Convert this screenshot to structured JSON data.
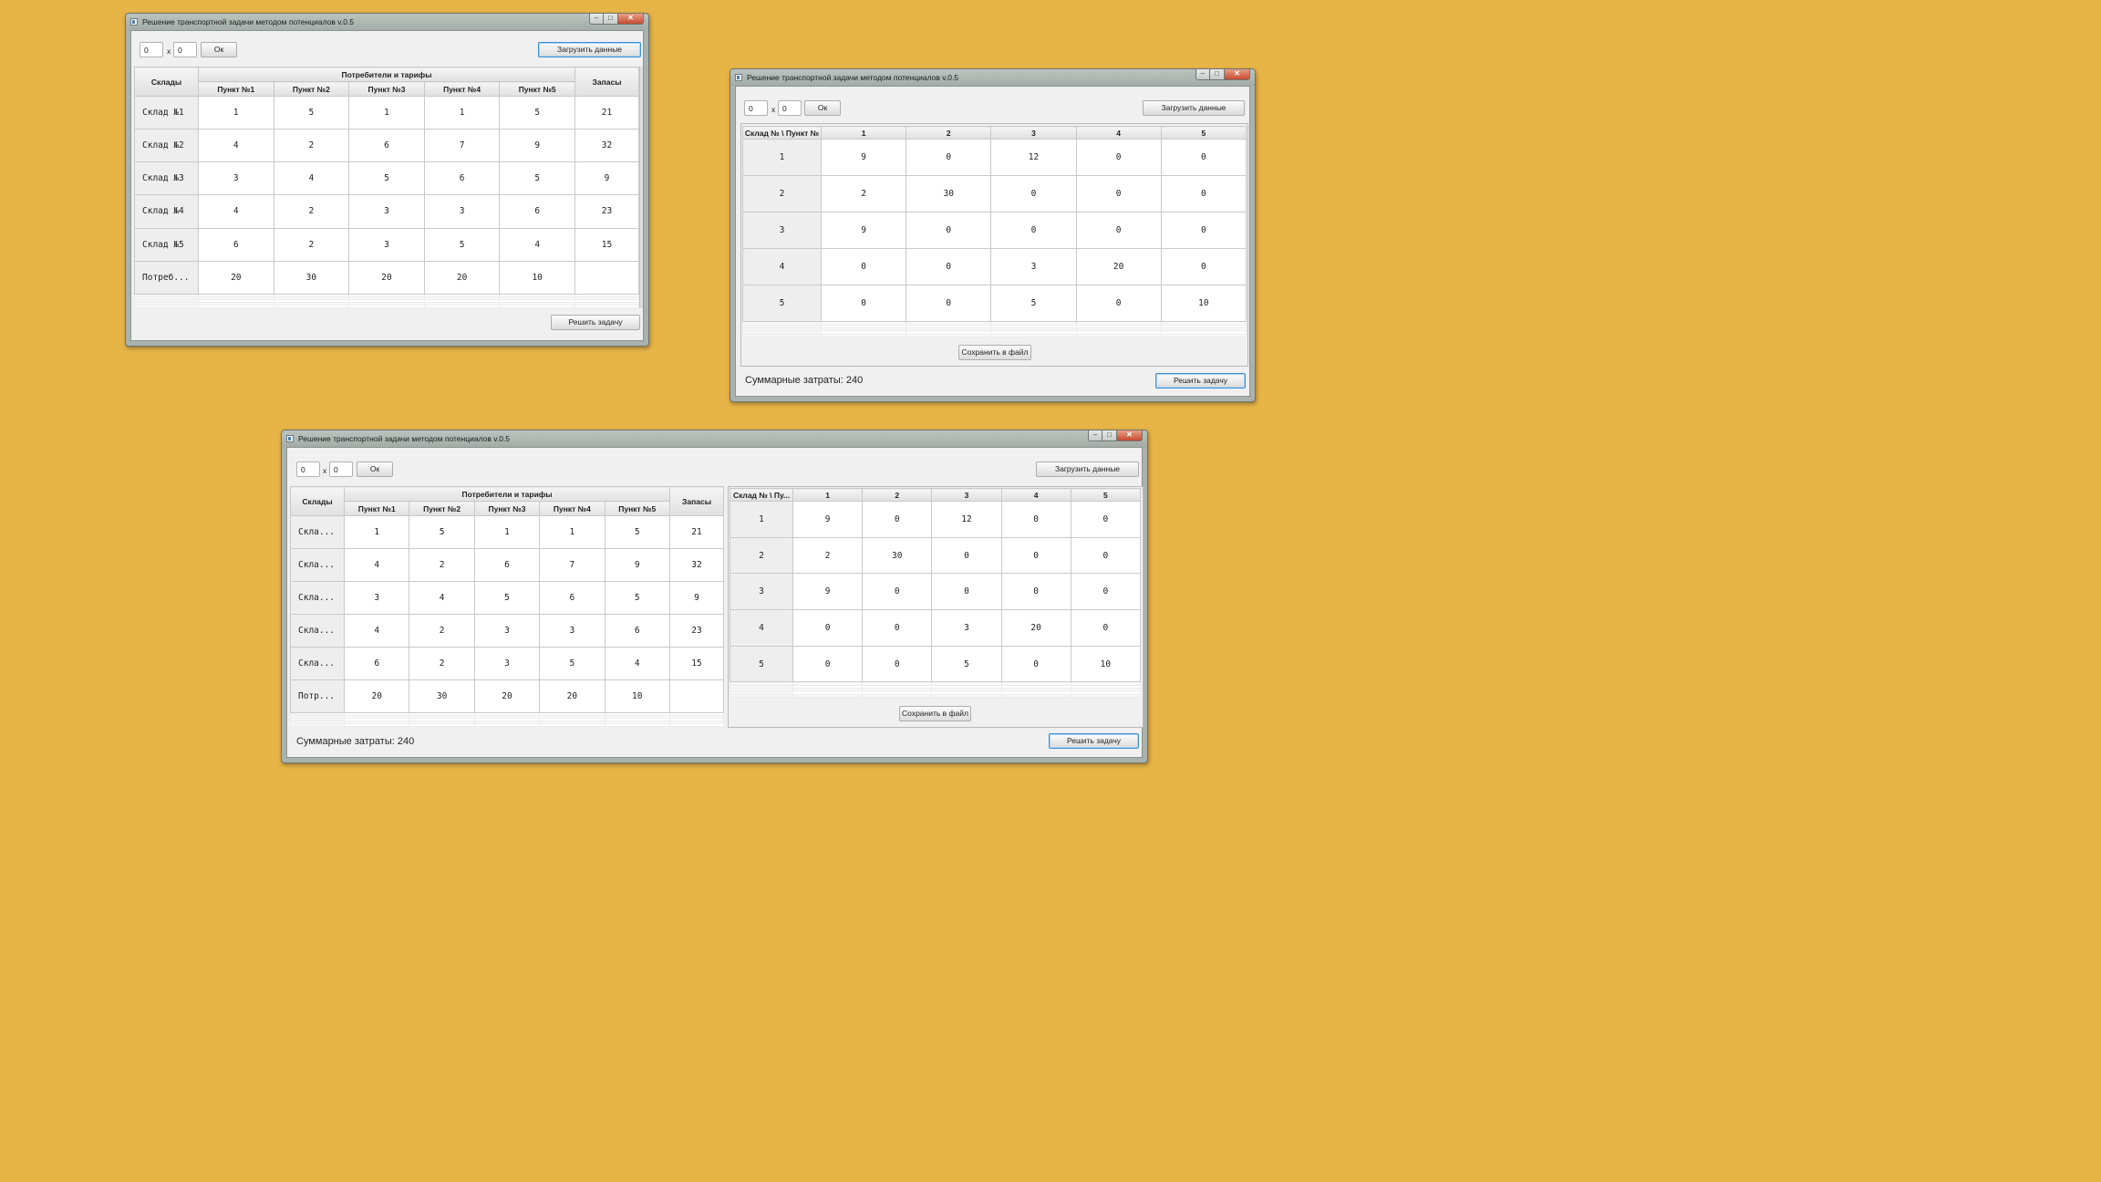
{
  "windows": {
    "input": {
      "title": "Решение транспортной задачи методом потенциалов v.0.5",
      "rows_input": "0",
      "cols_input": "0",
      "x_label": "x",
      "ok_label": "Ок",
      "load_label": "Загрузить данные",
      "solve_label": "Решить задачу",
      "table": {
        "warehouses_header": "Склады",
        "consumers_header": "Потребители и тарифы",
        "supply_header": "Запасы",
        "columns": [
          "Пункт №1",
          "Пункт №2",
          "Пункт №3",
          "Пункт №4",
          "Пункт №5"
        ],
        "rows": [
          {
            "label": "Склад №1",
            "values": [
              "1",
              "5",
              "1",
              "1",
              "5"
            ],
            "supply": "21"
          },
          {
            "label": "Склад №2",
            "values": [
              "4",
              "2",
              "6",
              "7",
              "9"
            ],
            "supply": "32"
          },
          {
            "label": "Склад №3",
            "values": [
              "3",
              "4",
              "5",
              "6",
              "5"
            ],
            "supply": "9"
          },
          {
            "label": "Склад №4",
            "values": [
              "4",
              "2",
              "3",
              "3",
              "6"
            ],
            "supply": "23"
          },
          {
            "label": "Склад №5",
            "values": [
              "6",
              "2",
              "3",
              "5",
              "4"
            ],
            "supply": "15"
          },
          {
            "label": "Потреб...",
            "values": [
              "20",
              "30",
              "20",
              "20",
              "10"
            ],
            "supply": ""
          }
        ]
      }
    },
    "result": {
      "title": "Решение транспортной задачи методом потенциалов v.0.5",
      "rows_input": "0",
      "cols_input": "0",
      "x_label": "x",
      "ok_label": "Ок",
      "load_label": "Загрузить данные",
      "save_label": "Сохранить в файл",
      "solve_label": "Решить задачу",
      "total_text": "Суммарные затраты: 240",
      "table": {
        "corner_header": "Склад № \\ Пункт №",
        "columns": [
          "1",
          "2",
          "3",
          "4",
          "5"
        ],
        "rows": [
          {
            "label": "1",
            "values": [
              "9",
              "0",
              "12",
              "0",
              "0"
            ]
          },
          {
            "label": "2",
            "values": [
              "2",
              "30",
              "0",
              "0",
              "0"
            ]
          },
          {
            "label": "3",
            "values": [
              "9",
              "0",
              "0",
              "0",
              "0"
            ]
          },
          {
            "label": "4",
            "values": [
              "0",
              "0",
              "3",
              "20",
              "0"
            ]
          },
          {
            "label": "5",
            "values": [
              "0",
              "0",
              "5",
              "0",
              "10"
            ]
          }
        ]
      }
    },
    "combined": {
      "title": "Решение транспортной задачи методом потенциалов v.0.5",
      "rows_input": "0",
      "cols_input": "0",
      "x_label": "x",
      "ok_label": "Ок",
      "load_label": "Загрузить данные",
      "save_label": "Сохранить в файл",
      "solve_label": "Решить задачу",
      "total_text": "Суммарные затраты: 240",
      "input_table": {
        "warehouses_header": "Склады",
        "consumers_header": "Потребители и тарифы",
        "supply_header": "Запасы",
        "columns": [
          "Пункт №1",
          "Пункт №2",
          "Пункт №3",
          "Пункт №4",
          "Пункт №5"
        ],
        "rows": [
          {
            "label": "Скла...",
            "values": [
              "1",
              "5",
              "1",
              "1",
              "5"
            ],
            "supply": "21"
          },
          {
            "label": "Скла...",
            "values": [
              "4",
              "2",
              "6",
              "7",
              "9"
            ],
            "supply": "32"
          },
          {
            "label": "Скла...",
            "values": [
              "3",
              "4",
              "5",
              "6",
              "5"
            ],
            "supply": "9"
          },
          {
            "label": "Скла...",
            "values": [
              "4",
              "2",
              "3",
              "3",
              "6"
            ],
            "supply": "23"
          },
          {
            "label": "Скла...",
            "values": [
              "6",
              "2",
              "3",
              "5",
              "4"
            ],
            "supply": "15"
          },
          {
            "label": "Потр...",
            "values": [
              "20",
              "30",
              "20",
              "20",
              "10"
            ],
            "supply": ""
          }
        ]
      },
      "result_table": {
        "corner_header": "Склад № \\ Пу...",
        "columns": [
          "1",
          "2",
          "3",
          "4",
          "5"
        ],
        "rows": [
          {
            "label": "1",
            "values": [
              "9",
              "0",
              "12",
              "0",
              "0"
            ]
          },
          {
            "label": "2",
            "values": [
              "2",
              "30",
              "0",
              "0",
              "0"
            ]
          },
          {
            "label": "3",
            "values": [
              "9",
              "0",
              "0",
              "0",
              "0"
            ]
          },
          {
            "label": "4",
            "values": [
              "0",
              "0",
              "3",
              "20",
              "0"
            ]
          },
          {
            "label": "5",
            "values": [
              "0",
              "0",
              "5",
              "0",
              "10"
            ]
          }
        ]
      }
    }
  },
  "colors": {
    "desktop_background": "#e7b447",
    "window_frame": "#a9b2ad",
    "close_button": "#c64a2f",
    "focus_border": "#3c8fd6"
  }
}
